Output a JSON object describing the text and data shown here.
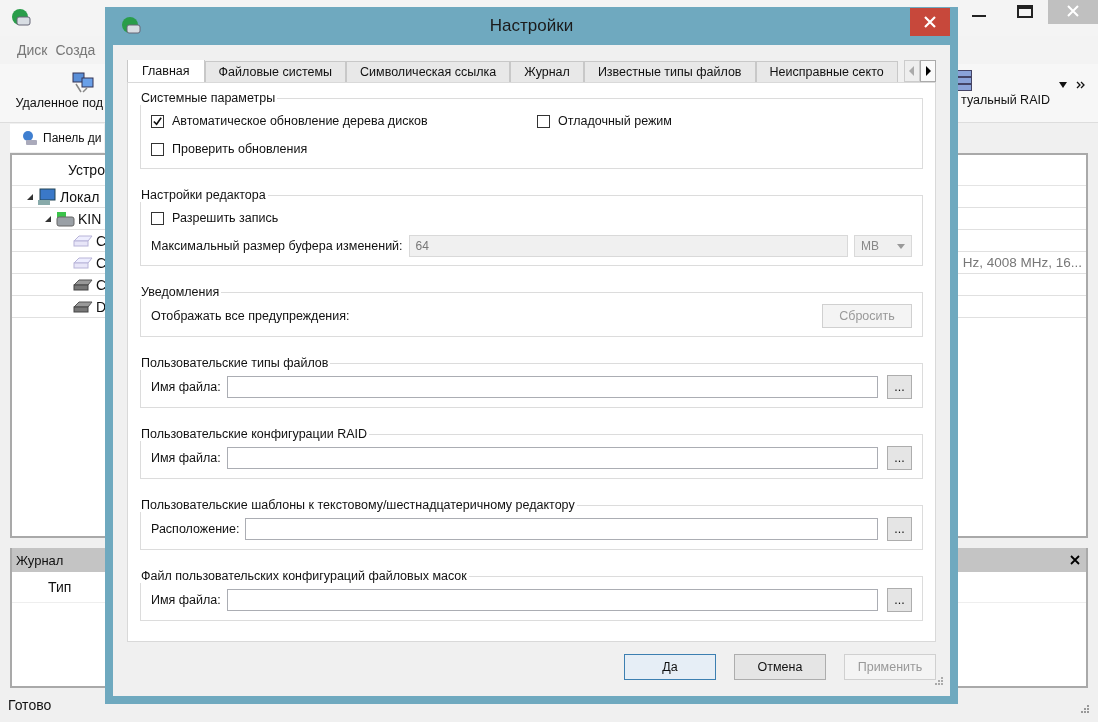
{
  "app": {
    "menu": [
      {
        "label": "Диск"
      },
      {
        "label": "Созда"
      }
    ],
    "toolbar_left": {
      "label": "Удаленное под"
    },
    "toolbar_right": {
      "label": "туальный RAID"
    },
    "panel_tab": {
      "label": "Панель ди"
    },
    "tree": {
      "column": "Устро",
      "items": [
        {
          "label": "Локал",
          "kind": "computer",
          "expanded": true,
          "children": [
            {
              "label": "KIN",
              "kind": "drive",
              "expanded": true,
              "children": [
                {
                  "label": "С",
                  "kind": "volume"
                },
                {
                  "label": "С",
                  "kind": "volume",
                  "details": "Hz, 4008 MHz, 16..."
                },
                {
                  "label": "С",
                  "kind": "disk"
                },
                {
                  "label": "D",
                  "kind": "disk"
                }
              ]
            }
          ]
        }
      ]
    },
    "log": {
      "title": "Журнал",
      "column": "Тип"
    },
    "status": "Готово"
  },
  "dialog": {
    "title": "Настройки",
    "tabs": [
      {
        "label": "Главная",
        "selected": true
      },
      {
        "label": "Файловые системы",
        "selected": false
      },
      {
        "label": "Символическая ссылка",
        "selected": false
      },
      {
        "label": "Журнал",
        "selected": false
      },
      {
        "label": "Известные типы файлов",
        "selected": false
      },
      {
        "label": "Неисправные секто",
        "selected": false
      }
    ],
    "groups": [
      {
        "title": "Системные параметры",
        "rows": [
          [
            {
              "kind": "checkbox",
              "label": "Автоматическое обновление дерева дисков",
              "checked": true
            },
            {
              "kind": "checkbox",
              "label": "Отладочный режим",
              "checked": false
            }
          ],
          [
            {
              "kind": "checkbox",
              "label": "Проверить обновления",
              "checked": false
            }
          ]
        ]
      },
      {
        "title": "Настройки редактора",
        "rows": [
          [
            {
              "kind": "checkbox",
              "label": "Разрешить запись",
              "checked": false
            }
          ],
          [
            {
              "kind": "buffer",
              "label": "Максимальный размер буфера изменений:",
              "value": "64",
              "unit": "MB",
              "disabled": true
            }
          ]
        ]
      },
      {
        "title": "Уведомления",
        "rows": [
          [
            {
              "kind": "reset",
              "label": "Отображать все предупреждения:",
              "button": "Сбросить",
              "disabled": true
            }
          ]
        ]
      },
      {
        "title": "Пользовательские типы файлов",
        "rows": [
          [
            {
              "kind": "path",
              "label": "Имя файла:",
              "button": "..."
            }
          ]
        ]
      },
      {
        "title": "Пользовательские конфигурации RAID",
        "rows": [
          [
            {
              "kind": "path",
              "label": "Имя файла:",
              "button": "..."
            }
          ]
        ]
      },
      {
        "title": "Пользовательские шаблоны к текстовому/шестнадцатеричному редактору",
        "rows": [
          [
            {
              "kind": "path",
              "label": "Расположение:",
              "button": "..."
            }
          ]
        ]
      },
      {
        "title": "Файл пользовательских конфигураций файловых масок",
        "rows": [
          [
            {
              "kind": "path",
              "label": "Имя файла:",
              "button": "..."
            }
          ]
        ]
      }
    ],
    "buttons": [
      {
        "label": "Да",
        "kind": "default",
        "disabled": false
      },
      {
        "label": "Отмена",
        "kind": "normal",
        "disabled": false
      },
      {
        "label": "Применить",
        "kind": "normal",
        "disabled": true
      }
    ]
  }
}
